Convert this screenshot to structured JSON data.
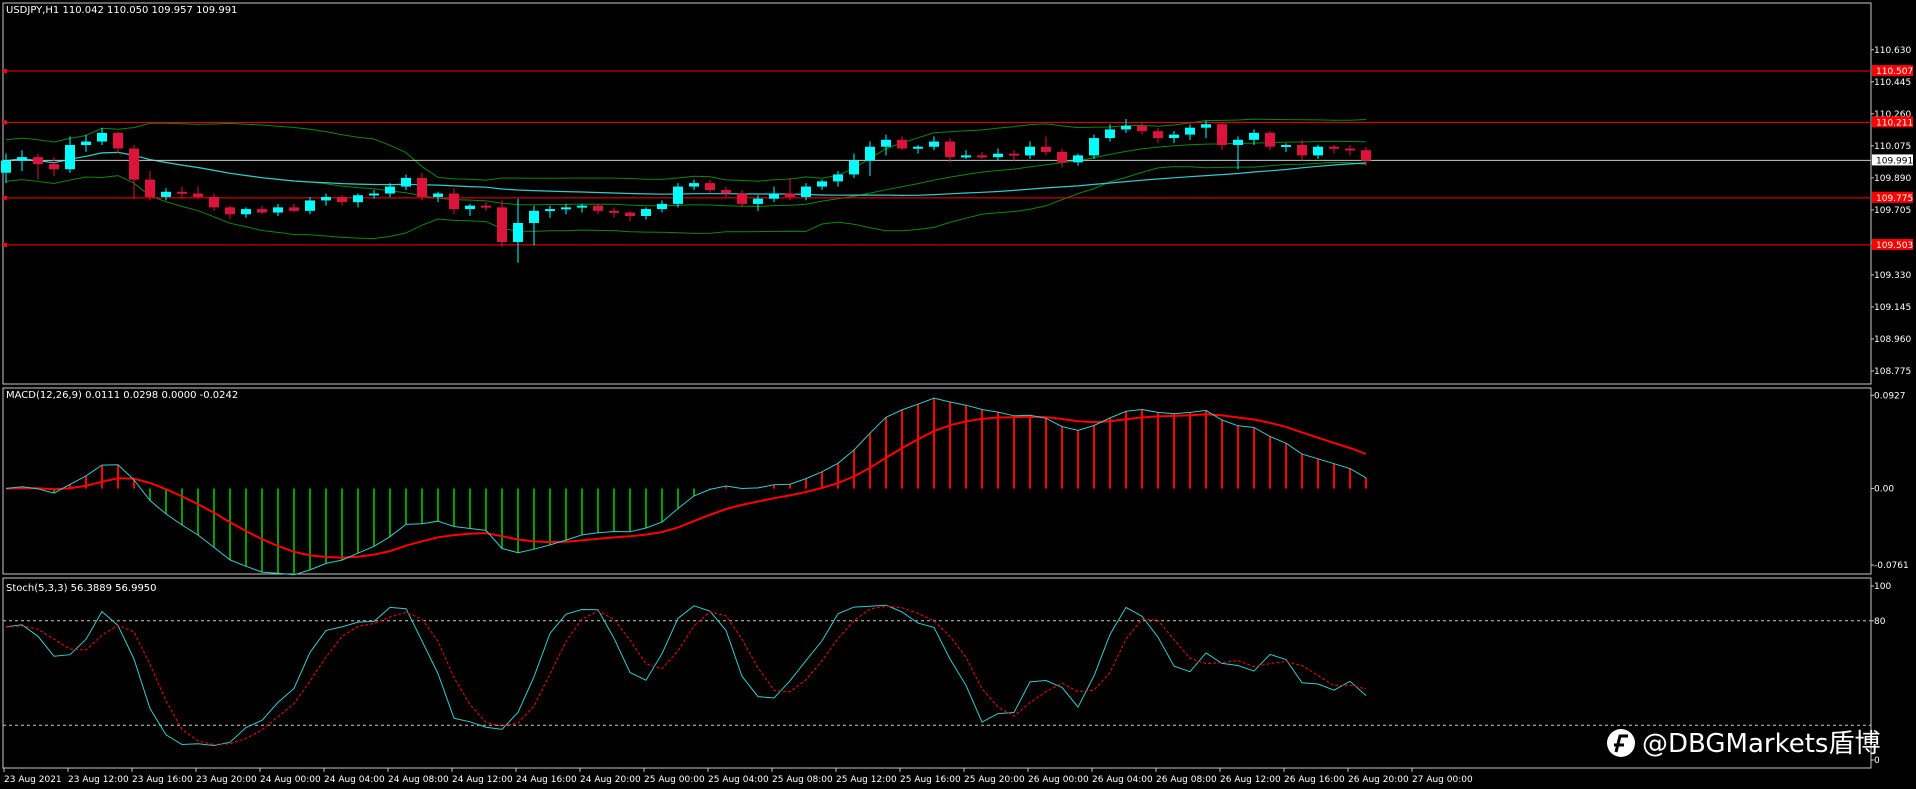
{
  "chart_data": [
    {
      "type": "candlestick",
      "title": "USDJPY,H1  110.042 110.050 109.957 109.991",
      "ylim": [
        108.7,
        110.9
      ],
      "ticks": [
        "110.630",
        "110.445",
        "110.260",
        "110.075",
        "109.890",
        "109.705",
        "109.515",
        "109.330",
        "109.145",
        "108.960",
        "108.775"
      ],
      "ticks_values": [
        110.63,
        110.445,
        110.26,
        110.075,
        109.89,
        109.705,
        109.515,
        109.33,
        109.145,
        108.96,
        108.775
      ],
      "current_price": "109.991",
      "current_price_value": 109.991,
      "hlines": [
        {
          "value": 110.507,
          "label": "110.507"
        },
        {
          "value": 110.211,
          "label": "110.211"
        },
        {
          "value": 109.775,
          "label": "109.775"
        },
        {
          "value": 109.503,
          "label": "109.503"
        }
      ],
      "candles": [
        [
          109.92,
          110.03,
          109.86,
          109.99
        ],
        [
          109.99,
          110.05,
          109.93,
          110.01
        ],
        [
          110.01,
          110.03,
          109.88,
          109.97
        ],
        [
          109.97,
          110.01,
          109.9,
          109.94
        ],
        [
          109.94,
          110.13,
          109.92,
          110.08
        ],
        [
          110.08,
          110.14,
          110.04,
          110.1
        ],
        [
          110.1,
          110.18,
          110.08,
          110.15
        ],
        [
          110.15,
          110.16,
          110.03,
          110.06
        ],
        [
          110.06,
          110.08,
          109.77,
          109.88
        ],
        [
          109.88,
          109.93,
          109.76,
          109.78
        ],
        [
          109.78,
          109.83,
          109.76,
          109.81
        ],
        [
          109.81,
          109.84,
          109.77,
          109.8
        ],
        [
          109.8,
          109.84,
          109.77,
          109.78
        ],
        [
          109.78,
          109.8,
          109.7,
          109.72
        ],
        [
          109.72,
          109.73,
          109.65,
          109.68
        ],
        [
          109.68,
          109.72,
          109.66,
          109.71
        ],
        [
          109.71,
          109.73,
          109.68,
          109.69
        ],
        [
          109.69,
          109.74,
          109.67,
          109.72
        ],
        [
          109.72,
          109.74,
          109.69,
          109.7
        ],
        [
          109.7,
          109.78,
          109.68,
          109.76
        ],
        [
          109.76,
          109.8,
          109.73,
          109.78
        ],
        [
          109.78,
          109.79,
          109.73,
          109.75
        ],
        [
          109.75,
          109.8,
          109.72,
          109.79
        ],
        [
          109.79,
          109.82,
          109.77,
          109.8
        ],
        [
          109.8,
          109.86,
          109.78,
          109.84
        ],
        [
          109.84,
          109.91,
          109.82,
          109.89
        ],
        [
          109.89,
          109.92,
          109.76,
          109.78
        ],
        [
          109.78,
          109.81,
          109.75,
          109.8
        ],
        [
          109.8,
          109.83,
          109.68,
          109.71
        ],
        [
          109.71,
          109.74,
          109.67,
          109.73
        ],
        [
          109.73,
          109.75,
          109.7,
          109.72
        ],
        [
          109.72,
          109.76,
          109.49,
          109.52
        ],
        [
          109.52,
          109.77,
          109.4,
          109.63
        ],
        [
          109.63,
          109.73,
          109.5,
          109.7
        ],
        [
          109.7,
          109.73,
          109.66,
          109.71
        ],
        [
          109.71,
          109.74,
          109.68,
          109.72
        ],
        [
          109.72,
          109.74,
          109.69,
          109.73
        ],
        [
          109.73,
          109.74,
          109.68,
          109.7
        ],
        [
          109.7,
          109.72,
          109.66,
          109.69
        ],
        [
          109.69,
          109.7,
          109.64,
          109.67
        ],
        [
          109.67,
          109.72,
          109.65,
          109.71
        ],
        [
          109.71,
          109.76,
          109.69,
          109.74
        ],
        [
          109.74,
          109.86,
          109.72,
          109.84
        ],
        [
          109.84,
          109.88,
          109.82,
          109.86
        ],
        [
          109.86,
          109.88,
          109.8,
          109.82
        ],
        [
          109.82,
          109.84,
          109.78,
          109.8
        ],
        [
          109.8,
          109.82,
          109.72,
          109.74
        ],
        [
          109.74,
          109.79,
          109.7,
          109.77
        ],
        [
          109.77,
          109.84,
          109.75,
          109.8
        ],
        [
          109.8,
          109.89,
          109.76,
          109.78
        ],
        [
          109.78,
          109.86,
          109.76,
          109.84
        ],
        [
          109.84,
          109.88,
          109.82,
          109.87
        ],
        [
          109.87,
          109.93,
          109.84,
          109.91
        ],
        [
          109.91,
          110.03,
          109.89,
          109.99
        ],
        [
          109.99,
          110.1,
          109.9,
          110.07
        ],
        [
          110.07,
          110.14,
          110.02,
          110.11
        ],
        [
          110.11,
          110.13,
          110.05,
          110.06
        ],
        [
          110.06,
          110.08,
          110.03,
          110.07
        ],
        [
          110.07,
          110.13,
          110.05,
          110.1
        ],
        [
          110.1,
          110.12,
          109.98,
          110.01
        ],
        [
          110.01,
          110.05,
          110.0,
          110.02
        ],
        [
          110.02,
          110.04,
          110.0,
          110.01
        ],
        [
          110.01,
          110.06,
          109.99,
          110.03
        ],
        [
          110.03,
          110.05,
          109.99,
          110.02
        ],
        [
          110.02,
          110.1,
          110.0,
          110.07
        ],
        [
          110.07,
          110.13,
          110.02,
          110.04
        ],
        [
          110.04,
          110.06,
          109.95,
          109.98
        ],
        [
          109.98,
          110.03,
          109.96,
          110.02
        ],
        [
          110.02,
          110.14,
          110.0,
          110.12
        ],
        [
          110.12,
          110.2,
          110.1,
          110.17
        ],
        [
          110.17,
          110.23,
          110.15,
          110.19
        ],
        [
          110.19,
          110.21,
          110.14,
          110.16
        ],
        [
          110.16,
          110.18,
          110.09,
          110.12
        ],
        [
          110.12,
          110.16,
          110.09,
          110.14
        ],
        [
          110.14,
          110.2,
          110.11,
          110.18
        ],
        [
          110.18,
          110.22,
          110.12,
          110.2
        ],
        [
          110.2,
          110.21,
          110.05,
          110.08
        ],
        [
          110.08,
          110.13,
          109.94,
          110.11
        ],
        [
          110.11,
          110.17,
          110.08,
          110.15
        ],
        [
          110.15,
          110.16,
          110.05,
          110.07
        ],
        [
          110.07,
          110.09,
          110.04,
          110.08
        ],
        [
          110.08,
          110.11,
          109.99,
          110.02
        ],
        [
          110.02,
          110.08,
          110.0,
          110.07
        ],
        [
          110.07,
          110.08,
          110.03,
          110.06
        ],
        [
          110.06,
          110.08,
          110.02,
          110.05
        ],
        [
          110.05,
          110.07,
          109.96,
          109.99
        ]
      ]
    },
    {
      "type": "line",
      "title": "MACD(12,26,9) 0.0111 0.0298 0.0000 -0.0242",
      "ylim": [
        -0.085,
        0.1
      ],
      "ticks": [
        "0.0927",
        "0.00",
        "-0.0761"
      ],
      "ticks_values": [
        0.0927,
        0.0,
        -0.0761
      ]
    },
    {
      "type": "line",
      "title": "Stoch(5,3,3) 56.3889 56.9950",
      "ylim": [
        0,
        100
      ],
      "ticks": [
        "100",
        "80",
        "0"
      ],
      "ticks_values": [
        100,
        80,
        0
      ],
      "levels": [
        80,
        20
      ]
    }
  ],
  "x_ticks": [
    "23 Aug 2021",
    "23 Aug 12:00",
    "23 Aug 16:00",
    "23 Aug 20:00",
    "24 Aug 00:00",
    "24 Aug 04:00",
    "24 Aug 08:00",
    "24 Aug 12:00",
    "24 Aug 16:00",
    "24 Aug 20:00",
    "25 Aug 00:00",
    "25 Aug 04:00",
    "25 Aug 08:00",
    "25 Aug 12:00",
    "25 Aug 16:00",
    "25 Aug 20:00",
    "26 Aug 00:00",
    "26 Aug 04:00",
    "26 Aug 08:00",
    "26 Aug 12:00",
    "26 Aug 16:00",
    "26 Aug 20:00",
    "27 Aug 00:00"
  ],
  "watermark": "@DBGMarkets盾博",
  "colors": {
    "bull": "#00ffff",
    "bear": "#dc143c",
    "bands": "#0a8a0a",
    "hline": "#ff0000",
    "macd_signal": "#ff0000",
    "macd_line": "#33cccc",
    "hist_pos": "#ff0000",
    "hist_neg": "#00a000"
  }
}
